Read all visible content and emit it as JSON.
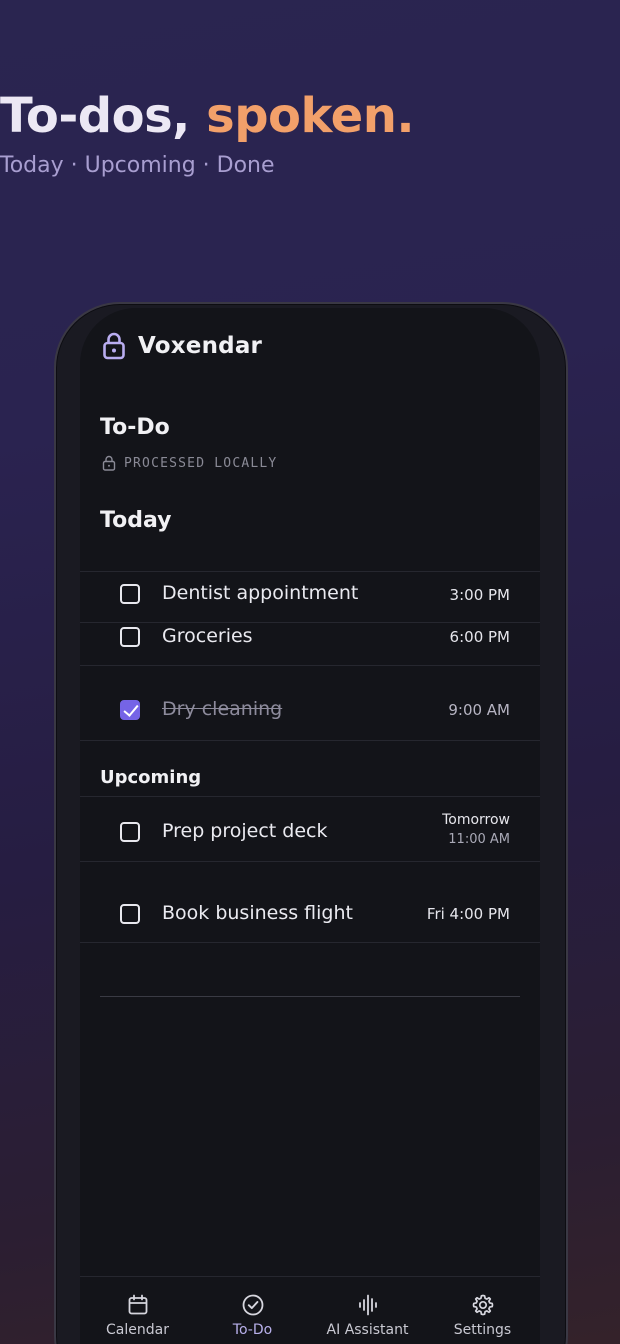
{
  "hero": {
    "title_main": "To-dos, ",
    "title_accent": "spoken.",
    "subtitle": "Today · Upcoming · Done"
  },
  "app": {
    "name": "Voxendar",
    "page_title": "To-Do",
    "local_label": "PROCESSED LOCALLY"
  },
  "sections": {
    "today": {
      "title": "Today",
      "tasks": [
        {
          "label": "Dentist appointment",
          "time": "3:00 PM",
          "done": false
        },
        {
          "label": "Groceries",
          "time": "6:00 PM",
          "done": false
        },
        {
          "label": "Dry cleaning",
          "time": "9:00 AM",
          "done": true
        }
      ]
    },
    "upcoming": {
      "title": "Upcoming",
      "tasks": [
        {
          "label": "Prep project deck",
          "time_line1": "Tomorrow",
          "time_line2": "11:00 AM",
          "done": false
        },
        {
          "label": "Book business flight",
          "time": "Fri 4:00 PM",
          "done": false
        }
      ]
    }
  },
  "tabbar": {
    "tabs": [
      {
        "label": "Calendar",
        "icon": "calendar-icon",
        "active": false
      },
      {
        "label": "To-Do",
        "icon": "check-circle-icon",
        "active": true
      },
      {
        "label": "AI Assistant",
        "icon": "waveform-icon",
        "active": false
      },
      {
        "label": "Settings",
        "icon": "gear-icon",
        "active": false
      }
    ]
  },
  "colors": {
    "accent": "#f2a06a",
    "check": "#7564e6",
    "active_tab": "#b8b0ea"
  }
}
